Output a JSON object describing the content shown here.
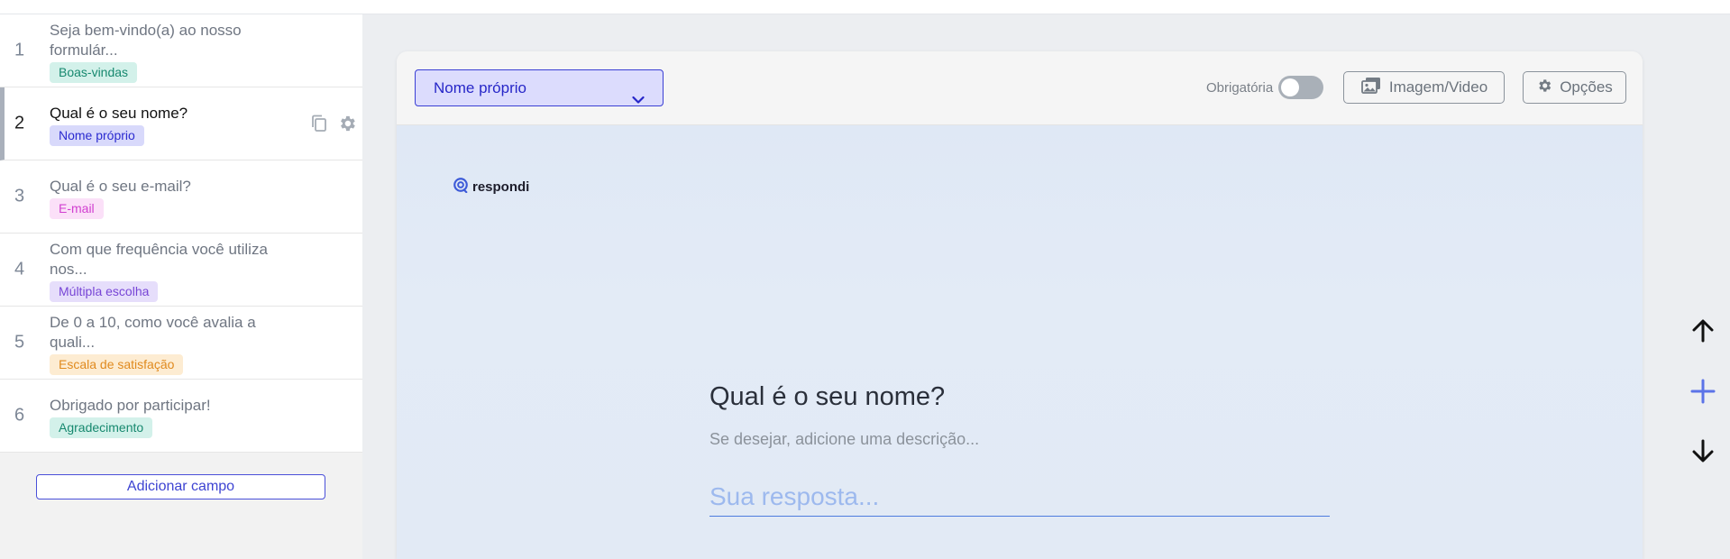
{
  "sidebar": {
    "fields": [
      {
        "num": "1",
        "title_line1": "Seja bem-vindo(a) ao nosso",
        "title_line2": "formulár...",
        "badge": "Boas-vindas"
      },
      {
        "num": "2",
        "title_line1": "Qual é o seu nome?",
        "title_line2": "",
        "badge": "Nome próprio"
      },
      {
        "num": "3",
        "title_line1": "Qual é o seu e-mail?",
        "title_line2": "",
        "badge": "E-mail"
      },
      {
        "num": "4",
        "title_line1": "Com que frequência você utiliza",
        "title_line2": "nos...",
        "badge": "Múltipla escolha"
      },
      {
        "num": "5",
        "title_line1": "De 0 a 10, como você avalia a quali...",
        "title_line2": "",
        "badge": "Escala de satisfação"
      },
      {
        "num": "6",
        "title_line1": "Obrigado por participar!",
        "title_line2": "",
        "badge": "Agradecimento"
      }
    ],
    "add_field_label": "Adicionar campo"
  },
  "toolbar": {
    "field_type": "Nome próprio",
    "required_label": "Obrigatória",
    "media_label": "Imagem/Video",
    "options_label": "Opções"
  },
  "preview": {
    "logo_text": "respondi",
    "question": "Qual é o seu nome?",
    "description": "Se desejar, adicione uma descrição...",
    "answer_placeholder": "Sua resposta..."
  },
  "colors": {
    "accent": "#3a3fd4",
    "badge_boas_vindas": "#17896f",
    "badge_nome": "#2b2bd0",
    "badge_email": "#d13fd0",
    "badge_multipla": "#7745d6",
    "badge_escala": "#e08a1e",
    "add_button": "#5b73e8"
  },
  "icons": {
    "duplicate": "duplicate-icon",
    "settings": "gear-icon",
    "media": "images-icon",
    "options": "gear-icon",
    "move_up": "arrow-up-icon",
    "add": "plus-icon",
    "move_down": "arrow-down-icon"
  }
}
